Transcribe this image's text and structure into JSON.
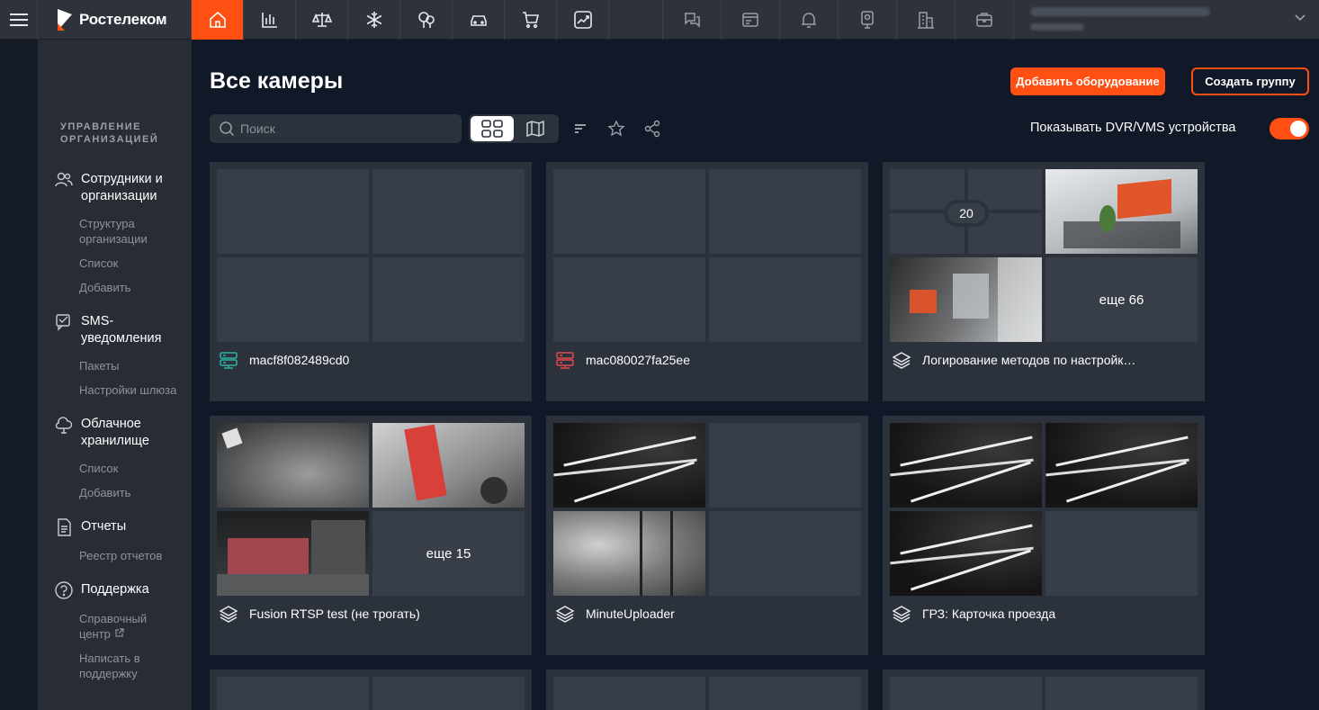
{
  "brand": {
    "name": "Ростелеком"
  },
  "nav": [
    "home-icon",
    "stats-icon",
    "scales-icon",
    "snowflake-icon",
    "trees-icon",
    "car-icon",
    "cart-icon",
    "growth-icon"
  ],
  "header_icons": [
    "chat-icon",
    "terminal-icon",
    "bell-icon",
    "camera-icon",
    "building-icon",
    "briefcase-icon"
  ],
  "sidebar": {
    "section_title": "УПРАВЛЕНИЕ ОРГАНИЗАЦИЕЙ",
    "groups": [
      {
        "label": "Сотрудники и организации",
        "icon": "users-icon",
        "items": [
          "Структура организации",
          "Список",
          "Добавить"
        ]
      },
      {
        "label": "SMS-уведомления",
        "icon": "sms-icon",
        "items": [
          "Пакеты",
          "Настройки шлюза"
        ]
      },
      {
        "label": "Облачное хранилище",
        "icon": "cloud-icon",
        "items": [
          "Список",
          "Добавить"
        ]
      },
      {
        "label": "Отчеты",
        "icon": "report-icon",
        "items": [
          "Реестр отчетов"
        ]
      },
      {
        "label": "Поддержка",
        "icon": "help-icon",
        "items": [
          "Справочный центр",
          "Написать в поддержку"
        ]
      }
    ]
  },
  "main": {
    "title": "Все камеры",
    "add_equipment": "Добавить оборудование",
    "create_group": "Создать группу",
    "search_placeholder": "Поиск",
    "dvr_toggle_label": "Показывать DVR/VMS устройства",
    "dvr_toggle_on": true
  },
  "cards": [
    {
      "title": "macf8f082489cd0",
      "icon": "server-icon",
      "icon_color": "#2bb3a0"
    },
    {
      "title": "mac080027fa25ee",
      "icon": "server-icon",
      "icon_color": "#e5484d"
    },
    {
      "title": "Логирование методов по настройк…",
      "icon": "layers-icon",
      "count_badge": "20",
      "more": "еще 66"
    },
    {
      "title": "Fusion RTSP test (не трогать)",
      "icon": "layers-icon",
      "more": "еще 15"
    },
    {
      "title": "MinuteUploader",
      "icon": "layers-icon"
    },
    {
      "title": "ГРЗ: Карточка проезда",
      "icon": "layers-icon"
    }
  ],
  "colors": {
    "accent": "#ff4f12",
    "bg": "#111827",
    "card": "#2c323c"
  }
}
